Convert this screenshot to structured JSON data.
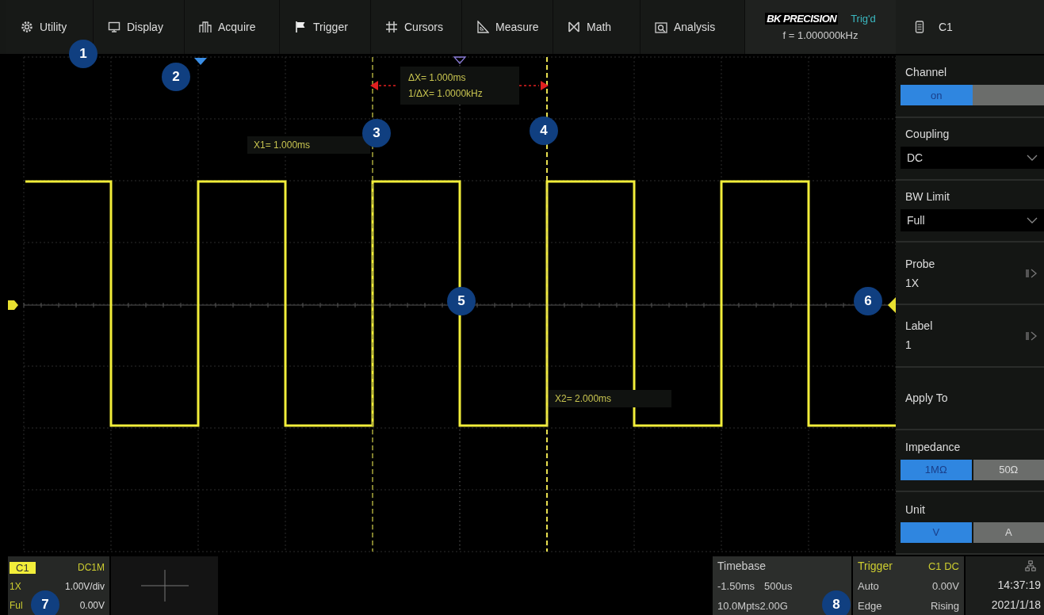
{
  "menu": [
    {
      "label": "Utility"
    },
    {
      "label": "Display"
    },
    {
      "label": "Acquire"
    },
    {
      "label": "Trigger"
    },
    {
      "label": "Cursors"
    },
    {
      "label": "Measure"
    },
    {
      "label": "Math"
    },
    {
      "label": "Analysis"
    }
  ],
  "brand": {
    "logo": "BK PRECISION",
    "trigger_status": "Trig'd",
    "frequency": "f = 1.000000kHz"
  },
  "channel_tab": {
    "label": "C1"
  },
  "cursors": {
    "delta": "ΔX= 1.000ms",
    "inverse_delta": "1/ΔX= 1.0000kHz",
    "x1": "X1= 1.000ms",
    "x2": "X2= 2.000ms"
  },
  "callouts": [
    "1",
    "2",
    "3",
    "4",
    "5",
    "6",
    "7",
    "8"
  ],
  "side_panel": [
    {
      "kind": "switch",
      "label": "Channel",
      "value": "on",
      "on": true
    },
    {
      "kind": "dropdown",
      "label": "Coupling",
      "value": "DC"
    },
    {
      "kind": "dropdown",
      "label": "BW Limit",
      "value": "Full"
    },
    {
      "kind": "submenu",
      "label": "Probe",
      "value": "1X"
    },
    {
      "kind": "submenu",
      "label": "Label",
      "value": "1"
    },
    {
      "kind": "action",
      "label": "Apply To"
    },
    {
      "kind": "segmented",
      "label": "Impedance",
      "options": [
        {
          "label": "1MΩ",
          "selected": true
        },
        {
          "label": "50Ω",
          "selected": false
        }
      ]
    },
    {
      "kind": "segmented",
      "label": "Unit",
      "options": [
        {
          "label": "V",
          "selected": true
        },
        {
          "label": "A",
          "selected": false
        }
      ]
    }
  ],
  "channel_info": {
    "name": "C1",
    "coupling": "DC1M",
    "probe": "1X",
    "scale": "1.00V/div",
    "bandwidth": "Ful",
    "offset": "0.00V"
  },
  "timebase": {
    "title": "Timebase",
    "delay": "-1.50ms",
    "scale": "500us",
    "memory": "10.0Mpts",
    "sample_rate": "2.00G"
  },
  "trigger": {
    "title": "Trigger",
    "source": "C1 DC",
    "mode": "Auto",
    "trigger_level": "0.00V",
    "type": "Edge",
    "slope": "Rising"
  },
  "clock": {
    "time": "14:37:19",
    "date": "2021/1/18"
  }
}
